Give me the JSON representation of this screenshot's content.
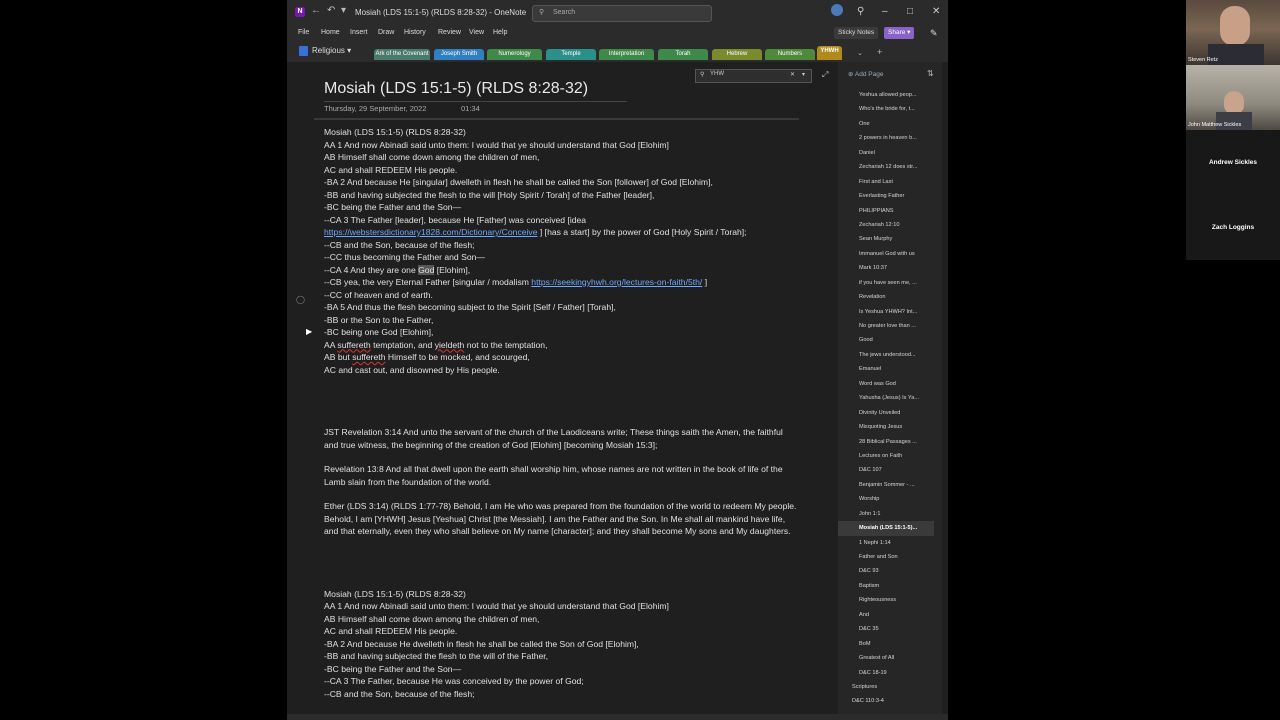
{
  "window": {
    "title": "Mosiah (LDS 15:1-5) (RLDS 8:28-32) - OneNote",
    "search_placeholder": "Search",
    "sticky_notes_label": "Sticky Notes",
    "share_label": "Share"
  },
  "menu": [
    "File",
    "Home",
    "Insert",
    "Draw",
    "History",
    "Review",
    "View",
    "Help"
  ],
  "notebook": {
    "name": "Religious"
  },
  "section_tabs": [
    {
      "label": "Ark of the Covenant",
      "color": "#4a7a6b"
    },
    {
      "label": "Joseph Smith",
      "color": "#2f7fc1"
    },
    {
      "label": "Numerology",
      "color": "#3f8a4a"
    },
    {
      "label": "Temple",
      "color": "#2b8f8a"
    },
    {
      "label": "Interpretation",
      "color": "#3f8a4a"
    },
    {
      "label": "Torah",
      "color": "#3f8a4a"
    },
    {
      "label": "Hebrew",
      "color": "#7a8a2e"
    },
    {
      "label": "Numbers",
      "color": "#4f8a3a"
    },
    {
      "label": "YHWH",
      "color": "#b08a1a",
      "active": true
    }
  ],
  "page": {
    "title": "Mosiah (LDS 15:1-5) (RLDS 8:28-32)",
    "date": "Thursday, 29 September, 2022",
    "time": "01:34",
    "find_query": "YHW"
  },
  "content": {
    "b1": [
      "Mosiah (LDS 15:1-5) (RLDS 8:28-32)",
      "AA 1 And now Abinadi said unto them: I would that ye should understand that God [Elohim]",
      "AB Himself shall come down among the children of men,",
      "AC and shall REDEEM His people.",
      "-BA 2 And because He [singular] dwelleth in flesh he shall be called the Son [follower] of God [Elohim],",
      "-BB and having subjected the flesh to the will [Holy Spirit / Torah] of the Father [leader],",
      "-BC being the Father and the Son—",
      "--CA 3 The Father [leader], because He [Father] was conceived [idea "
    ],
    "b1_link1": "https://webstersdictionary1828.com/Dictionary/Conceive",
    "b1_after_link1": " ] [has a start] by the power of God [Holy Spirit / Torah];",
    "b1b": [
      "--CB and the Son, because of the flesh;",
      "--CC thus becoming the Father and Son—"
    ],
    "ca4_pre": "--CA 4 And they are one ",
    "ca4_hl": "God",
    "ca4_post": " [Elohim],",
    "cb_pre": "--CB yea, the very Eternal Father [singular / modalism ",
    "cb_link": "https://seekingyhwh.org/lectures-on-faith/5th/",
    "cb_post": " ]",
    "b1c": [
      "--CC of heaven and of earth.",
      "-BA 5 And thus the flesh becoming subject to the Spirit [Self / Father] [Torah],",
      "-BB or the Son to the Father,",
      "-BC being one God [Elohim],"
    ],
    "aa_pre": "AA ",
    "aa_sq1": "suffereth",
    "aa_mid": " temptation, and ",
    "aa_sq2": "yieldeth",
    "aa_post": " not to the temptation,",
    "ab_pre": "AB but ",
    "ab_sq": "suffereth",
    "ab_post": " Himself to be mocked, and scourged,",
    "ac_last": "AC and cast out, and disowned by His people.",
    "p_rev314": "JST Revelation 3:14 And unto the servant of the church of the Laodiceans write; These things saith the Amen, the faithful and true witness, the beginning of the creation of God [Elohim] [becoming Mosiah 15:3];",
    "p_rev138": "Revelation 13:8 And all that dwell upon the earth shall worship him, whose names are not written in the book of life of the Lamb slain from the foundation of the world.",
    "p_ether": "Ether (LDS 3:14) (RLDS 1:77-78) Behold, I am He who was prepared from the foundation of the world to redeem My people. Behold, I am [YHWH] Jesus [Yeshua] Christ [the Messiah]. I am the Father and the Son. In Me shall all mankind have life, and that eternally, even they who shall believe on My name [character]; and they shall become My sons and My daughters.",
    "b2": [
      "Mosiah (LDS 15:1-5) (RLDS 8:28-32)",
      "AA 1 And now Abinadi said unto them: I would that ye should understand that God [Elohim]",
      "AB Himself shall come down among the children of men,",
      "AC and shall REDEEM His people.",
      "-BA 2 And because He dwelleth in flesh he shall be called the Son of God [Elohim],",
      "-BB and having subjected the flesh to the will of the Father,",
      "-BC being the Father and the Son—",
      "--CA 3 The Father, because He was conceived by the power of God;",
      "--CB and the Son, because of the flesh;"
    ]
  },
  "sidebar": {
    "add_page_label": "Add Page",
    "pages": [
      {
        "label": "Yeshua allowed peop..."
      },
      {
        "label": "Who's the bride for, t..."
      },
      {
        "label": "One"
      },
      {
        "label": "2 powers in heaven b..."
      },
      {
        "label": "Daniel"
      },
      {
        "label": "Zechariah 12 does str..."
      },
      {
        "label": "First and Last"
      },
      {
        "label": "Everlasting Father"
      },
      {
        "label": "PHILIPPIANS"
      },
      {
        "label": "Zechariah 12:10"
      },
      {
        "label": "Sean Murphy"
      },
      {
        "label": "Immanuel God with us"
      },
      {
        "label": "Mark 10:37"
      },
      {
        "label": "if you have seen me, ..."
      },
      {
        "label": "Revelation"
      },
      {
        "label": "Is Yeshua YHWH? Int..."
      },
      {
        "label": "No greater love than ..."
      },
      {
        "label": "Good"
      },
      {
        "label": "The jews understood..."
      },
      {
        "label": "Emanuel"
      },
      {
        "label": "Word was God"
      },
      {
        "label": "Yahusha (Jesus) Is Ya..."
      },
      {
        "label": "Divinity Unveiled"
      },
      {
        "label": "Misquoting Jesus"
      },
      {
        "label": "28 Biblical Passages ..."
      },
      {
        "label": "Lectures on Faith"
      },
      {
        "label": "D&C 107"
      },
      {
        "label": "Benjamin Sommer - ..."
      },
      {
        "label": "Worship"
      },
      {
        "label": "John 1:1"
      },
      {
        "label": "Mosiah (LDS 15:1-5)...",
        "selected": true
      },
      {
        "label": "1 Nephi 1:14"
      },
      {
        "label": "Father and Son"
      },
      {
        "label": "D&C 93"
      },
      {
        "label": "Baptism"
      },
      {
        "label": "Righteousness"
      },
      {
        "label": "And"
      },
      {
        "label": "D&C 35"
      },
      {
        "label": "BoM"
      },
      {
        "label": "Greatest of All"
      },
      {
        "label": "D&C 18-19"
      },
      {
        "label": "Scriptures",
        "top": true
      },
      {
        "label": "D&C 110:3-4",
        "top": true
      }
    ]
  },
  "participants": [
    {
      "name": "Steven Retz"
    },
    {
      "name": "John Matthew Sickles"
    },
    {
      "name": "Andrew Sickles"
    },
    {
      "name": "Zach Loggins"
    }
  ]
}
